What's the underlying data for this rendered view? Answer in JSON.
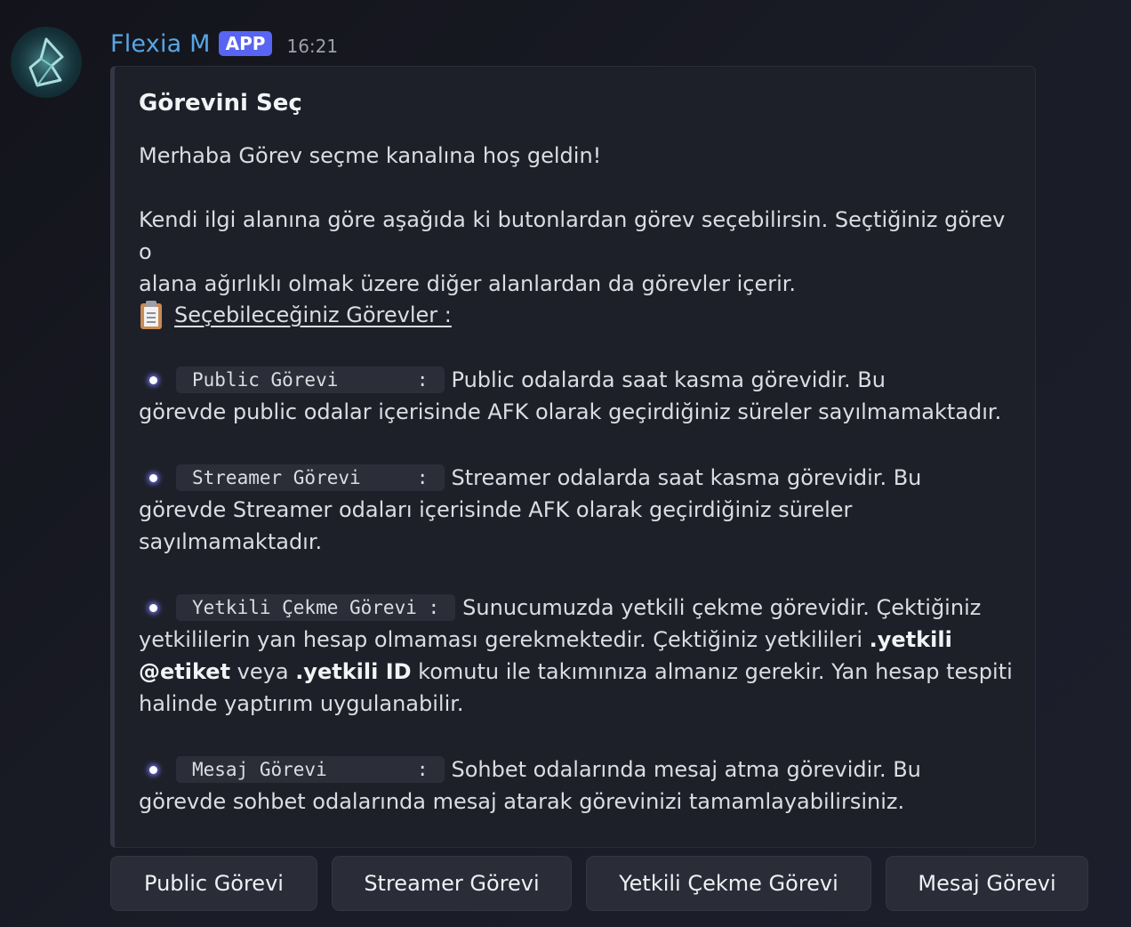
{
  "message": {
    "author": "Flexia M",
    "badge": "APP",
    "time": "16:21"
  },
  "embed": {
    "title": "Görevini Seç",
    "welcome": "Merhaba Görev seçme kanalına hoş geldin!",
    "intro_line1": "Kendi ilgi alanına göre aşağıda ki butonlardan görev seçebilirsin. Seçtiğiniz görev o",
    "intro_line2": "alana ağırlıklı olmak üzere diğer alanlardan da görevler içerir.",
    "tasks_heading": "Seçebileceğiniz Görevler :",
    "tasks_heading_icon": "clipboard-icon",
    "tasks": [
      {
        "code": "Public Görevi       :",
        "line1": "Public odalarda saat kasma görevidir. Bu",
        "line2": "görevde public odalar içerisinde AFK olarak geçirdiğiniz süreler sayılmamaktadır."
      },
      {
        "code": "Streamer Görevi     :",
        "line1": "Streamer odalarda saat kasma görevidir. Bu",
        "line2": "görevde Streamer odaları içerisinde AFK olarak geçirdiğiniz süreler",
        "line3": "sayılmamaktadır."
      },
      {
        "code": "Yetkili Çekme Görevi :",
        "line1": "Sunucumuzda yetkili çekme görevidir. Çektiğiniz",
        "line2a": "yetkililerin yan hesap olmaması gerekmektedir. Çektiğiniz yetkilileri ",
        "line2b": ".yetkili",
        "line3a": "@etiket",
        "line3b": " veya ",
        "line3c": ".yetkili ID",
        "line3d": " komutu ile takımınıza almanız gerekir. Yan hesap tespiti",
        "line4": "halinde yaptırım uygulanabilir."
      },
      {
        "code": "Mesaj Görevi        :",
        "line1": "Sohbet odalarında mesaj atma görevidir. Bu",
        "line2": "görevde sohbet odalarında mesaj atarak görevinizi tamamlayabilirsiniz."
      }
    ]
  },
  "buttons": [
    "Public Görevi",
    "Streamer Görevi",
    "Yetkili Çekme Görevi",
    "Mesaj Görevi"
  ],
  "colors": {
    "username": "#58a6e6",
    "app_badge": "#5865f2",
    "embed_bg": "#1e2029",
    "button_bg": "#2a2c37"
  }
}
